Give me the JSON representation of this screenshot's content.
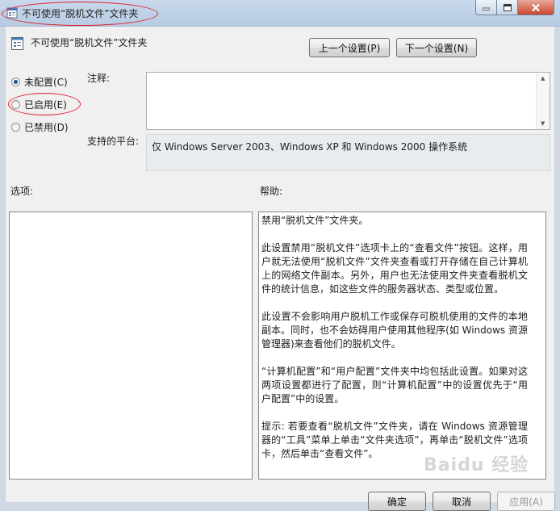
{
  "window": {
    "title": "不可使用“脱机文件”文件夹",
    "minimize_icon": "minimize-icon",
    "maximize_icon": "maximize-icon",
    "close_icon": "close-icon"
  },
  "header": {
    "policy_name": "不可使用“脱机文件”文件夹",
    "prev_button": "上一个设置(P)",
    "next_button": "下一个设置(N)"
  },
  "state_options": [
    {
      "label": "未配置(C)",
      "selected": true
    },
    {
      "label": "已启用(E)",
      "selected": false
    },
    {
      "label": "已禁用(D)",
      "selected": false
    }
  ],
  "comment": {
    "label": "注释:",
    "value": ""
  },
  "platform": {
    "label": "支持的平台:",
    "value": "仅 Windows Server 2003、Windows XP 和 Windows 2000 操作系统"
  },
  "options": {
    "label": "选项:"
  },
  "help": {
    "label": "帮助:",
    "paragraphs": [
      "禁用“脱机文件”文件夹。",
      "此设置禁用“脱机文件”选项卡上的“查看文件”按钮。这样，用户就无法使用“脱机文件”文件夹查看或打开存储在自己计算机上的网络文件副本。另外，用户也无法使用文件夹查看脱机文件的统计信息，如这些文件的服务器状态、类型或位置。",
      "此设置不会影响用户脱机工作或保存可脱机使用的文件的本地副本。同时，也不会妨碍用户使用其他程序(如 Windows 资源管理器)来查看他们的脱机文件。",
      "“计算机配置”和“用户配置”文件夹中均包括此设置。如果对这两项设置都进行了配置，则“计算机配置”中的设置优先于“用户配置”中的设置。",
      "提示: 若要查看“脱机文件”文件夹，请在 Windows 资源管理器的“工具”菜单上单击“文件夹选项”，再单击“脱机文件”选项卡，然后单击“查看文件”。"
    ]
  },
  "footer": {
    "ok": "确定",
    "cancel": "取消",
    "apply": "应用(A)"
  },
  "watermark": "Baidu 经验",
  "colors": {
    "annotation": "#e0202a",
    "titlebar": "#c9d9ec",
    "client": "#f0f0f0"
  }
}
